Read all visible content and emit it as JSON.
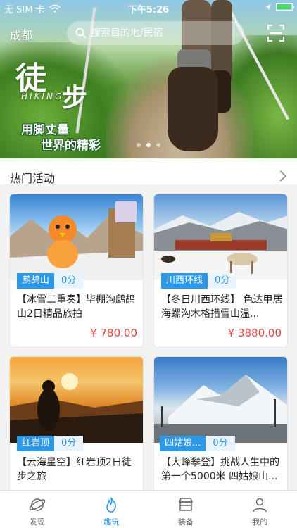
{
  "status_bar": {
    "carrier": "无 SIM 卡",
    "time": "下午5:26"
  },
  "header": {
    "city": "成都",
    "search_placeholder": "搜索目的地/民宿"
  },
  "banner": {
    "calligraphy_1": "徒",
    "calligraphy_2": "步",
    "english": "HIKING",
    "slogan_line1": "用脚丈量",
    "slogan_line2": "世界的精彩",
    "page_count": 3,
    "active_page": 2
  },
  "section": {
    "title": "热门活动"
  },
  "cards": [
    {
      "tag": "鹧鸪山",
      "score": "0分",
      "description": "【冰雪二重奏】毕棚沟鹧鸪山2日精品旅拍",
      "price": "¥ 780.00"
    },
    {
      "tag": "川西环线",
      "score": "0分",
      "description": "【冬日川西环线】 色达甲居海螺沟木格措雪山温...",
      "price": "¥ 3880.00"
    },
    {
      "tag": "红岩顶",
      "score": "0分",
      "description": "【云海星空】红岩顶2日徒步之旅",
      "price": ""
    },
    {
      "tag": "四姑娘...",
      "score": "0分",
      "description": "【大峰攀登】挑战人生中的第一个5000米 四姑娘山...",
      "price": ""
    }
  ],
  "tabs": [
    {
      "label": "发现",
      "icon": "planet-icon"
    },
    {
      "label": "趣玩",
      "icon": "flame-icon"
    },
    {
      "label": "装备",
      "icon": "shop-icon"
    },
    {
      "label": "我的",
      "icon": "user-icon"
    }
  ],
  "colors": {
    "accent": "#2d97e8",
    "price": "#e64340"
  }
}
